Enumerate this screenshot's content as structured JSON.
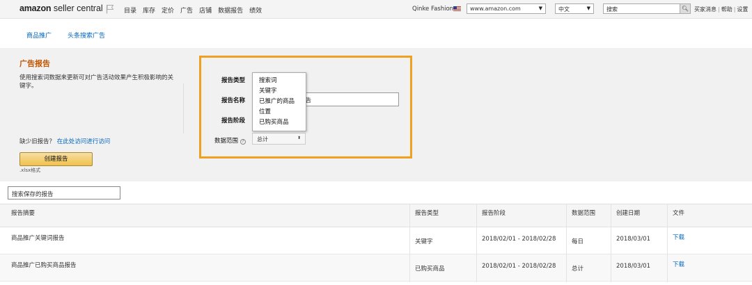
{
  "topbar": {
    "logo_bold": "amazon",
    "logo_rest": " seller central",
    "nav": [
      "目录",
      "库存",
      "定价",
      "广告",
      "店铺",
      "数据报告",
      "绩效"
    ],
    "account_name": "Qinke Fashion",
    "marketplace": "www.amazon.com",
    "language": "中文",
    "search_placeholder": "搜索",
    "links": [
      "买家消息",
      "帮助",
      "设置"
    ]
  },
  "tabs": [
    {
      "label": "商品推广"
    },
    {
      "label": "头条搜索广告"
    }
  ],
  "report_panel": {
    "title": "广告报告",
    "description": "使用搜索词数据来更新可对广告活动效果产生积极影响的关键字。",
    "legacy_text": "缺少旧报告？",
    "legacy_link": "在此处访问进行访问",
    "create_button": "创建报告",
    "format_note": ".xlsx格式",
    "labels": {
      "report_type": "报告类型",
      "report_name": "报告名称",
      "report_period": "报告阶段",
      "data_range": "数据范围"
    },
    "report_name_value": "告",
    "data_range_value": "总计",
    "dropdown_options": [
      "搜索词",
      "关键字",
      "已推广的商品",
      "位置",
      "已购买商品"
    ]
  },
  "table": {
    "search_placeholder": "搜索保存的报告",
    "headers": [
      "报告摘要",
      "报告类型",
      "报告阶段",
      "数据范围",
      "创建日期",
      "文件"
    ],
    "rows": [
      {
        "summary": "商品推广关键词报告",
        "type": "关键字",
        "period": "2018/02/01 - 2018/02/28",
        "range": "每日",
        "created": "2018/03/01",
        "file": "下载"
      },
      {
        "summary": "商品推广已购买商品报告",
        "type": "已购买商品",
        "period": "2018/02/01 - 2018/02/28",
        "range": "总计",
        "created": "2018/03/01",
        "file": "下载"
      }
    ]
  },
  "colors": {
    "accent_orange": "#f0a020",
    "title_orange": "#c45500",
    "link_blue": "#0066c0",
    "button_yellow": "#f0c14b"
  }
}
